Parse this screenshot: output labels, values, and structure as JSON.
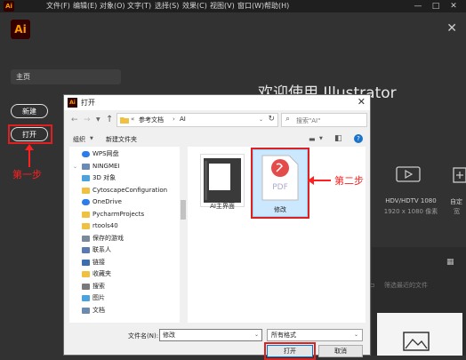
{
  "menubar": {
    "logo": "Ai",
    "items": [
      "文件(F)",
      "编辑(E)",
      "对象(O)",
      "文字(T)",
      "选择(S)",
      "效果(C)",
      "视图(V)",
      "窗口(W)",
      "帮助(H)"
    ],
    "window_buttons": [
      "—",
      "□",
      "✕"
    ]
  },
  "home": {
    "logo": "Ai",
    "close": "✕",
    "home_label": "主页",
    "new_label": "新建",
    "open_label": "打开",
    "step1": "第一步",
    "welcome": "欢迎使用 Illustrator",
    "presets": [
      {
        "label": "HDV/HDTV 1080",
        "sub": "1920 x 1080 像素"
      },
      {
        "label": "自定",
        "sub": "宽"
      }
    ],
    "recent_filter": "筛选最近的文件"
  },
  "dialog": {
    "logo": "Ai",
    "title": "打开",
    "close": "✕",
    "address": {
      "part1": "参考文档",
      "part2": "AI"
    },
    "search_placeholder": "搜索\"AI\"",
    "toolbar": {
      "organize": "组织",
      "new_folder": "新建文件夹"
    },
    "nav_items": [
      {
        "label": "WPS网盘",
        "icon": "cloud-icon",
        "color": "#2b7de9",
        "chev": ""
      },
      {
        "label": "NINGMEI",
        "icon": "user-icon",
        "color": "#6b8ab5",
        "chev": "⌄"
      },
      {
        "label": "3D 对象",
        "icon": "cube-icon",
        "color": "#4aa3df",
        "chev": ""
      },
      {
        "label": "CytoscapeConfiguration",
        "icon": "folder-icon",
        "color": "#f0c040",
        "chev": ""
      },
      {
        "label": "OneDrive",
        "icon": "cloud-icon",
        "color": "#2b7de9",
        "chev": ""
      },
      {
        "label": "PycharmProjects",
        "icon": "folder-icon",
        "color": "#f0c040",
        "chev": ""
      },
      {
        "label": "rtools40",
        "icon": "folder-icon",
        "color": "#f0c040",
        "chev": ""
      },
      {
        "label": "保存的游戏",
        "icon": "game-icon",
        "color": "#7a8a9a",
        "chev": ""
      },
      {
        "label": "联系人",
        "icon": "contacts-icon",
        "color": "#5a7ab0",
        "chev": ""
      },
      {
        "label": "链接",
        "icon": "link-icon",
        "color": "#3c6fb0",
        "chev": ""
      },
      {
        "label": "收藏夹",
        "icon": "star-icon",
        "color": "#f0c040",
        "chev": ""
      },
      {
        "label": "搜索",
        "icon": "search-icon",
        "color": "#7a7a7a",
        "chev": ""
      },
      {
        "label": "图片",
        "icon": "pictures-icon",
        "color": "#4aa3df",
        "chev": ""
      },
      {
        "label": "文档",
        "icon": "documents-icon",
        "color": "#6a8ab0",
        "chev": ""
      }
    ],
    "files": [
      {
        "name": "AI主界面"
      },
      {
        "name": "修改",
        "badge": "PDF"
      }
    ],
    "step2": "第二步",
    "filename_label": "文件名(N):",
    "filename_value": "修改",
    "filetype_value": "所有格式",
    "open_button": "打开",
    "cancel_button": "取消"
  }
}
